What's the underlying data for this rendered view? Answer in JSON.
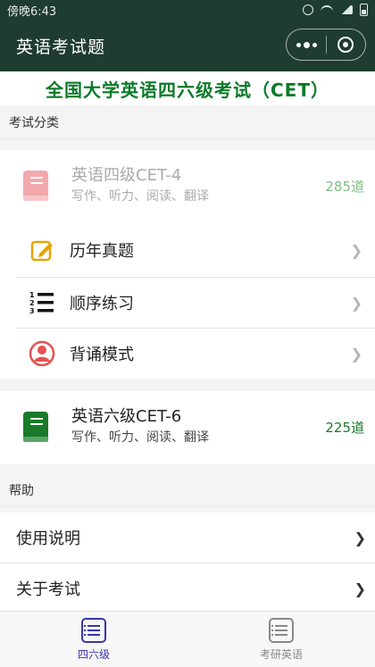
{
  "status_bar": {
    "time": "傍晚6:43"
  },
  "nav_bar": {
    "title": "英语考试题"
  },
  "headline": "全国大学英语四六级考试（CET）",
  "section_exam": "考试分类",
  "levels": [
    {
      "name": "英语四级CET-4",
      "desc": "写作、听力、阅读、翻译",
      "count": "285道",
      "book_color": "#f3a9ab"
    },
    {
      "name": "英语六级CET-6",
      "desc": "写作、听力、阅读、翻译",
      "count": "225道",
      "book_color": "#1a7a2a"
    }
  ],
  "practice_modes": [
    {
      "label": "历年真题",
      "icon": "pencil-note-icon"
    },
    {
      "label": "顺序练习",
      "icon": "ordered-list-icon"
    },
    {
      "label": "背诵模式",
      "icon": "user-avatar-icon"
    }
  ],
  "section_help": "帮助",
  "help_items": [
    {
      "label": "使用说明"
    },
    {
      "label": "关于考试"
    }
  ],
  "tabs": [
    {
      "label": "四六级",
      "icon": "list-icon",
      "active": true
    },
    {
      "label": "考研英语",
      "icon": "list-icon",
      "active": false
    }
  ],
  "colors": {
    "nav_bg": "#1f3c30",
    "headline": "#0b7a28",
    "tab_active": "#3a37a8"
  }
}
